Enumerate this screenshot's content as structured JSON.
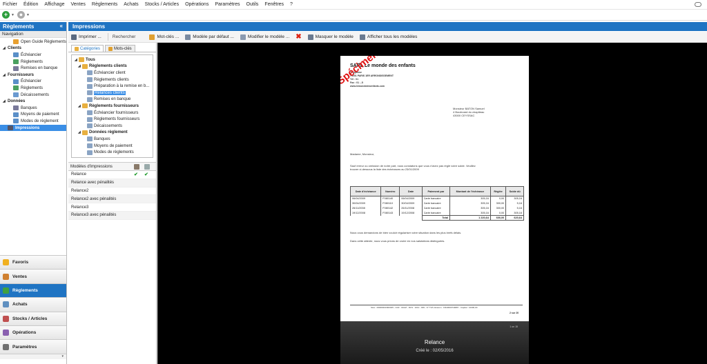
{
  "menu": [
    "Fichier",
    "Édition",
    "Affichage",
    "Ventes",
    "Règlements",
    "Achats",
    "Stocks / Articles",
    "Opérations",
    "Paramètres",
    "Outils",
    "Fenêtres",
    "?"
  ],
  "left_panel": {
    "title": "Règlements",
    "collapse": "«",
    "nav_label": "Navigation",
    "tree": [
      {
        "label": "Open Guide Règlements",
        "level": 1,
        "icon": "guide-icon",
        "color": "#e8a030"
      },
      {
        "label": "Clients",
        "level": 0
      },
      {
        "label": "Échéancier",
        "level": 1,
        "icon": "calendar-icon",
        "color": "#5a8fc8"
      },
      {
        "label": "Règlements",
        "level": 1,
        "icon": "payment-icon",
        "color": "#4aa060"
      },
      {
        "label": "Remises en banque",
        "level": 1,
        "icon": "bank-icon",
        "color": "#7a7a9a"
      },
      {
        "label": "Fournisseurs",
        "level": 0
      },
      {
        "label": "Échéancier",
        "level": 1,
        "icon": "calendar-icon",
        "color": "#5a8fc8"
      },
      {
        "label": "Règlements",
        "level": 1,
        "icon": "payment-icon",
        "color": "#4aa060"
      },
      {
        "label": "Décaissements",
        "level": 1,
        "icon": "cash-icon",
        "color": "#6a9ad0"
      },
      {
        "label": "Données",
        "level": 0
      },
      {
        "label": "Banques",
        "level": 1,
        "icon": "bank-icon",
        "color": "#7a7a9a"
      },
      {
        "label": "Moyens de paiement",
        "level": 1,
        "icon": "payment-method-icon",
        "color": "#5a8fc8"
      },
      {
        "label": "Modes de règlement",
        "level": 1,
        "icon": "settlement-icon",
        "color": "#5a8fc8"
      },
      {
        "label": "Impressions",
        "level": 0,
        "icon": "printer-icon",
        "color": "#556",
        "selected": true
      }
    ]
  },
  "nav_buttons": [
    {
      "label": "Favoris",
      "icon": "star-icon",
      "color": "#f0b020"
    },
    {
      "label": "Ventes",
      "icon": "sales-icon",
      "color": "#d08030"
    },
    {
      "label": "Règlements",
      "icon": "payment-icon",
      "color": "#40a040",
      "active": true
    },
    {
      "label": "Achats",
      "icon": "purchase-icon",
      "color": "#6090c0"
    },
    {
      "label": "Stocks / Articles",
      "icon": "stock-icon",
      "color": "#c05050"
    },
    {
      "label": "Opérations",
      "icon": "operations-icon",
      "color": "#8a60b0"
    },
    {
      "label": "Paramètres",
      "icon": "settings-icon",
      "color": "#707070"
    }
  ],
  "nav_bottom": "▾",
  "right_panel": {
    "title": "Impressions"
  },
  "toolbar": {
    "print": "Imprimer ...",
    "search": "Rechercher",
    "keywords": "Mot-clés ...",
    "default_model": "Modèle par défaut ...",
    "edit_model": "Modifier le modèle ...",
    "delete": "✖",
    "hide_model": "Masquer le modèle",
    "show_all": "Afficher tous les modèles"
  },
  "tabs": {
    "categories": "Catégories",
    "keywords": "Mots-clés"
  },
  "categories": [
    {
      "label": "Tous",
      "indent": 0,
      "bold": true,
      "tri": "▾"
    },
    {
      "label": "Règlements clients",
      "indent": 1,
      "bold": true,
      "tri": "▾"
    },
    {
      "label": "Échéancier client",
      "indent": 2
    },
    {
      "label": "Règlements clients",
      "indent": 2
    },
    {
      "label": "Préparation à la remise en b...",
      "indent": 2
    },
    {
      "label": "Relances clients",
      "indent": 2,
      "selected": true
    },
    {
      "label": "Remises en banque",
      "indent": 2
    },
    {
      "label": "Règlements fournisseurs",
      "indent": 1,
      "bold": true,
      "tri": "▾"
    },
    {
      "label": "Échéancier fournisseurs",
      "indent": 2
    },
    {
      "label": "Règlements fournisseurs",
      "indent": 2
    },
    {
      "label": "Décaissements",
      "indent": 2
    },
    {
      "label": "Données règlement",
      "indent": 1,
      "bold": true,
      "tri": "▾"
    },
    {
      "label": "Banques",
      "indent": 2
    },
    {
      "label": "Moyens de paiement",
      "indent": 2
    },
    {
      "label": "Modes de règlements",
      "indent": 2
    }
  ],
  "models": {
    "header": "Modèles d'impressions",
    "rows": [
      {
        "label": "Relance",
        "checks": "✔✔"
      },
      {
        "label": "Relance avec pénalités"
      },
      {
        "label": "Relance2"
      },
      {
        "label": "Relance2 avec pénalités"
      },
      {
        "label": "Relance3"
      },
      {
        "label": "Relance3 avec pénalités"
      }
    ]
  },
  "preview": {
    "company": "SARL Le monde des enfants",
    "company_lines": [
      "7 impasse",
      "75001 PARIS 1ER ARRONDISSEMENT",
      "Tél : 01",
      "Fax : 01 ...5",
      "www.lemondedesenfants.com"
    ],
    "watermark": "Spécimen",
    "recipient": [
      "Monsieur BATON Samuel",
      "4 Boulevard du chapiteau",
      "43000 CEYSSAC"
    ],
    "salutation": "Madame, Monsieur,",
    "intro": [
      "Sauf erreur ou omission de notre part, nous constatons que vous n'avez pas réglé votre solde.  Veuillez",
      "trouver ci-dessous la liste des échéances au 23/01/2009"
    ],
    "table": {
      "headers": [
        "Date d'échéance",
        "Numéro",
        "Date",
        "Paiement par",
        "Montant de l'échéance",
        "Réglée",
        "Solde dû"
      ],
      "rows": [
        [
          "06/04/2009",
          "F080140",
          "06/04/2009",
          "Carte bancaire",
          "305,16",
          "0,00",
          "305,16"
        ],
        [
          "30/04/2009",
          "F080110",
          "30/04/2009",
          "Carte bancaire",
          "305,16",
          "300,00",
          "5,16"
        ],
        [
          "26/11/2008",
          "F080142",
          "26/11/2008",
          "Carte bancaire",
          "305,16",
          "300,00",
          "5,16"
        ],
        [
          "19/12/2008",
          "F080143",
          "19/12/2008",
          "Carte bancaire",
          "305,16",
          "0,00",
          "305,16"
        ]
      ],
      "total_label": "Total",
      "total": [
        "1 220,64",
        "600,00",
        "620,64"
      ]
    },
    "closing1": "Nous vous demandons de bien vouloir régulariser votre situation dans les plus brefs délais.",
    "closing2": "Dans cette attente, nous vous prions de croire en nos salutations distinguées.",
    "footer": "Siret : 00000004/000045 - NAF : 0111Z - RCS : 1012 - 009 - N° TVA intracom : FR40000749087 - Capital : 12000,00",
    "page": "2 sur 20",
    "footer2": "1 on 15",
    "caption_title": "Relance",
    "caption_sub": "Créé le : 02/05/2016"
  }
}
